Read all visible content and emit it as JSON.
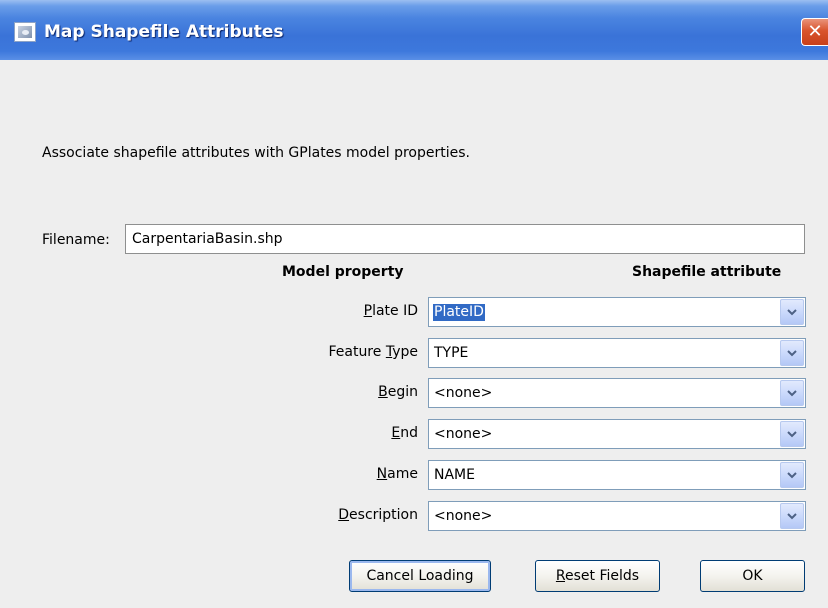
{
  "window": {
    "title": "Map Shapefile Attributes",
    "close_glyph": "✕",
    "icon": "document-icon"
  },
  "description": "Associate shapefile attributes with GPlates model properties.",
  "filename": {
    "label": "Filename:",
    "value": "CarpentariaBasin.shp"
  },
  "columns": {
    "model": "Model property",
    "shapefile": "Shapefile attribute"
  },
  "properties": [
    {
      "label": "Plate ID",
      "mnemonic": "P",
      "value": "PlateID",
      "selected": true
    },
    {
      "label": "Feature Type",
      "mnemonic": "T",
      "value": "TYPE"
    },
    {
      "label": "Begin",
      "mnemonic": "B",
      "value": "<none>"
    },
    {
      "label": "End",
      "mnemonic": "E",
      "value": "<none>"
    },
    {
      "label": "Name",
      "mnemonic": "N",
      "value": "NAME"
    },
    {
      "label": "Description",
      "mnemonic": "D",
      "value": "<none>"
    }
  ],
  "buttons": {
    "cancel": "Cancel Loading",
    "reset": "Reset Fields",
    "ok": "OK"
  },
  "colors": {
    "titlebar": "#3a73d8",
    "selection": "#316ac5",
    "close": "#d9542c"
  }
}
